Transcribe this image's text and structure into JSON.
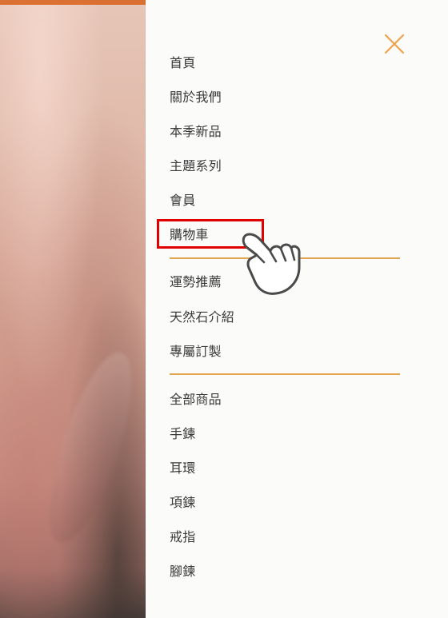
{
  "icons": {
    "close": "close-icon",
    "hand": "pointing-hand-icon"
  },
  "colors": {
    "accent": "#e2a34d",
    "close_icon": "#f0a24b",
    "highlight": "#e00000",
    "text": "#3a3a3a"
  },
  "menu": {
    "items": [
      {
        "label": "首頁"
      },
      {
        "label": "關於我們"
      },
      {
        "label": "本季新品"
      },
      {
        "label": "主題系列"
      },
      {
        "label": "會員"
      },
      {
        "label": "購物車"
      },
      {
        "label": "運勢推薦"
      },
      {
        "label": "天然石介紹"
      },
      {
        "label": "專屬訂製"
      },
      {
        "label": "全部商品"
      },
      {
        "label": "手鍊"
      },
      {
        "label": "耳環"
      },
      {
        "label": "項鍊"
      },
      {
        "label": "戒指"
      },
      {
        "label": "腳鍊"
      }
    ]
  }
}
